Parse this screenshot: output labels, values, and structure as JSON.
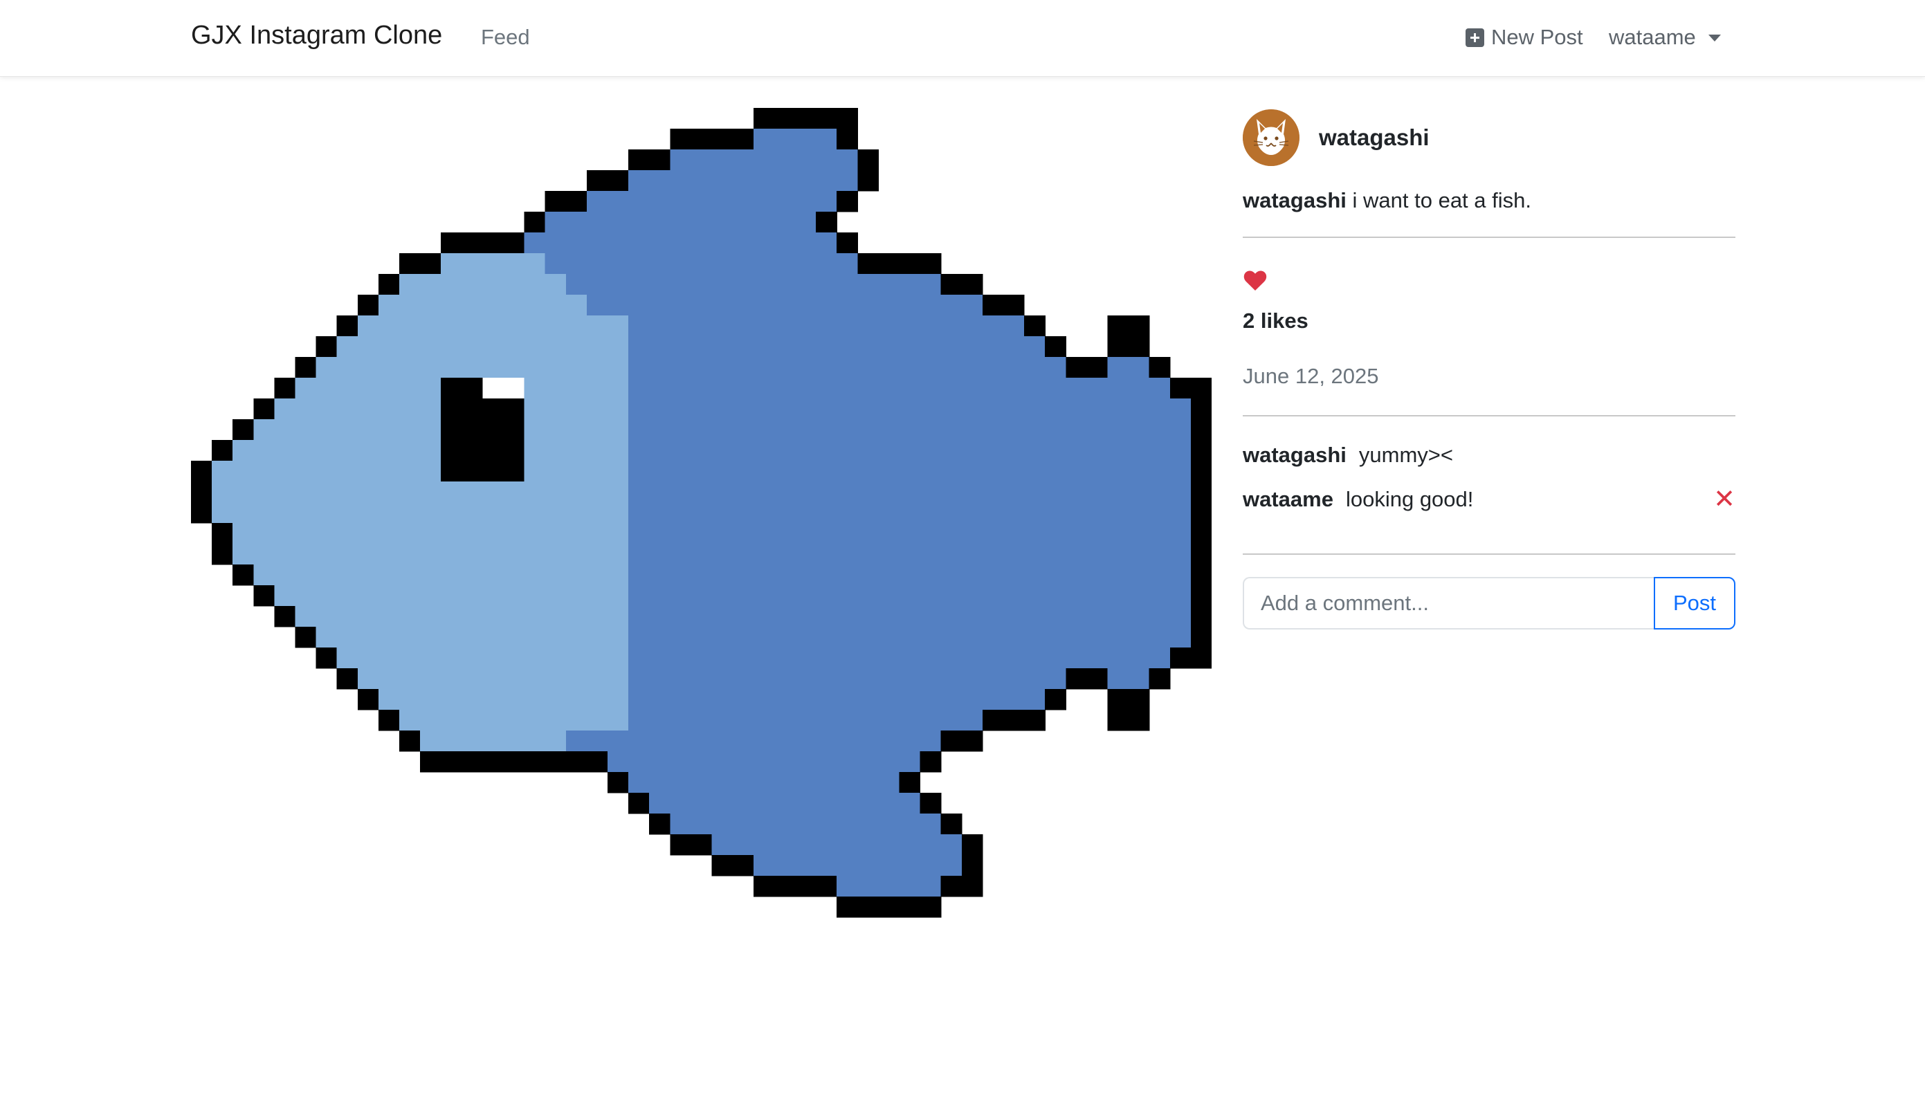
{
  "navbar": {
    "brand": "GJX Instagram Clone",
    "feed_label": "Feed",
    "new_post_label": "New Post",
    "new_post_icon": "plus-square-icon",
    "user_label": "wataame",
    "user_menu_icon": "caret-down-icon"
  },
  "post": {
    "image_subject": "pixel-art-fish",
    "author": "watagashi",
    "avatar_icon": "cat-face-icon",
    "caption_user": "watagashi",
    "caption_text": "i want to eat a fish.",
    "like_icon": "heart-icon",
    "likes": "2 likes",
    "date": "June 12, 2025"
  },
  "comments": [
    {
      "user": "watagashi",
      "text": "yummy><",
      "deletable": false
    },
    {
      "user": "wataame",
      "text": "looking good!",
      "deletable": true,
      "delete_icon": "close-icon"
    }
  ],
  "comment_form": {
    "placeholder": "Add a comment...",
    "submit_label": "Post"
  },
  "colors": {
    "fish_body": "#5480c2",
    "fish_face": "#86b2dc",
    "outline": "#000000",
    "heart": "#dc3545",
    "delete": "#dc3545",
    "post_button": "#0d6efd",
    "avatar": "#b9712c"
  }
}
